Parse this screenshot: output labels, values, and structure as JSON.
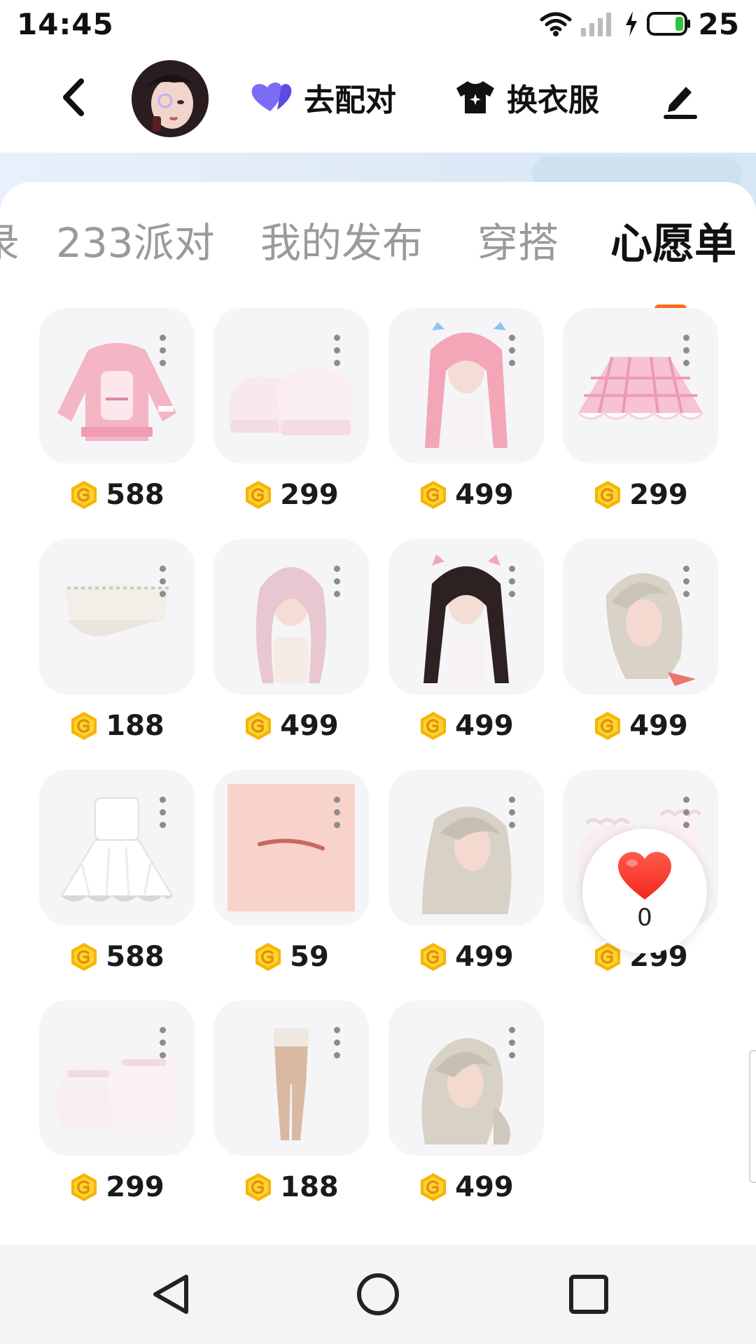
{
  "status_bar": {
    "time": "14:45",
    "battery": "25"
  },
  "nav": {
    "match_label": "去配对",
    "outfit_label": "换衣服"
  },
  "tabs": [
    {
      "label": "录",
      "active": false
    },
    {
      "label": "233派对",
      "active": false
    },
    {
      "label": "我的发布",
      "active": false
    },
    {
      "label": "穿搭",
      "active": false
    },
    {
      "label": "心愿单",
      "active": true
    }
  ],
  "items": [
    {
      "kind": "pink-sweater-icon",
      "price": "588"
    },
    {
      "kind": "white-platform-shoes-icon",
      "price": "299"
    },
    {
      "kind": "pink-twintail-hair-icon",
      "price": "499"
    },
    {
      "kind": "pink-plaid-skirt-icon",
      "price": "299"
    },
    {
      "kind": "white-tube-top-icon",
      "price": "188"
    },
    {
      "kind": "pink-wavy-hair-icon",
      "price": "499"
    },
    {
      "kind": "black-twintail-hair-icon",
      "price": "499"
    },
    {
      "kind": "ash-blonde-hair-icon",
      "price": "499"
    },
    {
      "kind": "white-dress-icon",
      "price": "588"
    },
    {
      "kind": "lip-makeup-icon",
      "price": "59"
    },
    {
      "kind": "long-ash-hair-icon",
      "price": "499"
    },
    {
      "kind": "white-frill-platform-icon",
      "price": "299"
    },
    {
      "kind": "white-mary-jane-icon",
      "price": "299"
    },
    {
      "kind": "nude-tights-icon",
      "price": "188"
    },
    {
      "kind": "low-pigtail-hair-icon",
      "price": "499"
    }
  ],
  "like": {
    "count": "0"
  },
  "colors": {
    "accent": "#ff6a1a",
    "coin": "#f7b500",
    "heart": "#ff3b30",
    "match_heart": "#6a5cf0"
  }
}
